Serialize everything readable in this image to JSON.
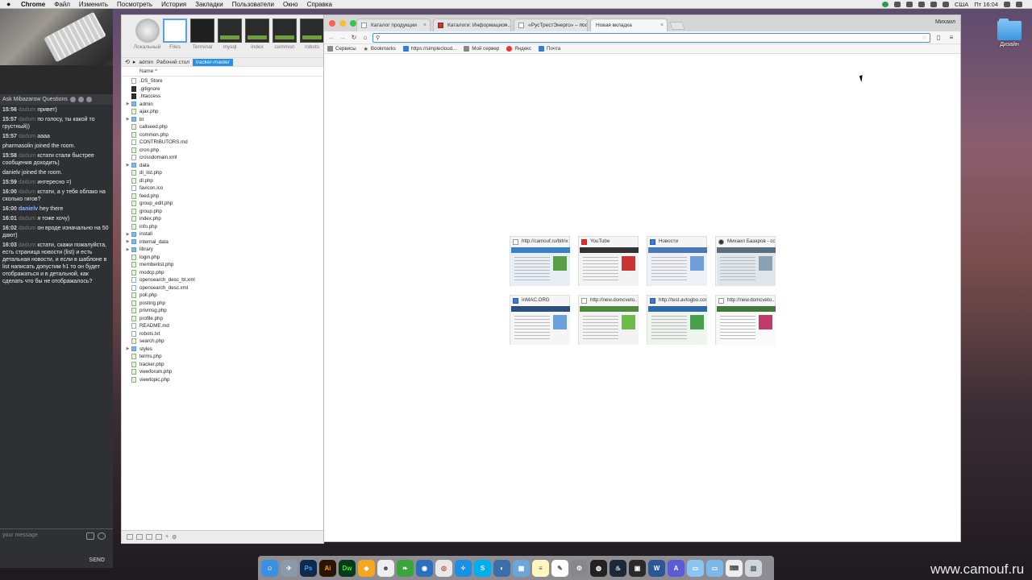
{
  "menubar": {
    "apple": "",
    "items": [
      "Chrome",
      "Файл",
      "Изменить",
      "Посмотреть",
      "История",
      "Закладки",
      "Пользователи",
      "Окно",
      "Справка"
    ],
    "lang": "США",
    "clock": "Пт 16:04"
  },
  "chat": {
    "title": "Ask Mibazarow Questions",
    "messages": [
      {
        "time": "15:56",
        "user": "dadum",
        "text": "привет)"
      },
      {
        "time": "15:57",
        "user": "dadum",
        "text": "по голосу, ты какой то грустный))"
      },
      {
        "time": "15:57",
        "user": "dadum",
        "text": "аааа"
      },
      {
        "time": "",
        "user": "",
        "text": "pharmasolin joined the room."
      },
      {
        "time": "15:58",
        "user": "dadum",
        "text": "кстати стали быстрее сообщения доходить)"
      },
      {
        "time": "",
        "user": "",
        "text": "danielv joined the room."
      },
      {
        "time": "15:59",
        "user": "dadum",
        "text": "интересно =)"
      },
      {
        "time": "16:00",
        "user": "dadum",
        "text": "кстати, а у тебя облако на сколько гигов?"
      },
      {
        "time": "16:00",
        "user": "danielv",
        "text": "hey there",
        "highlight": true
      },
      {
        "time": "16:01",
        "user": "dadum",
        "text": "я тоже хочу)"
      },
      {
        "time": "16:02",
        "user": "dadum",
        "text": "он вроде изначально на 50 дают)"
      },
      {
        "time": "16:03",
        "user": "dadum",
        "text": "кстати, скажи пожалуйста, есть страница новости (list) и есть детальная новости, и если в шаблоне в list написать допустим h1 то он будет отображаться и в детальной, как сделать что бы не отображалось?"
      }
    ],
    "input_placeholder": "your message",
    "send_label": "SEND"
  },
  "filemanager": {
    "toolbar": [
      {
        "label": "Локальный",
        "kind": "globe"
      },
      {
        "label": "Files",
        "kind": "sel"
      },
      {
        "label": "Terminal",
        "kind": "dark"
      },
      {
        "label": "mysql",
        "kind": "code"
      },
      {
        "label": "index",
        "kind": "code"
      },
      {
        "label": "common",
        "kind": "code"
      },
      {
        "label": "robots",
        "kind": "code"
      }
    ],
    "breadcrumb": [
      "admin",
      "Рабочий стол",
      "tracker-master"
    ],
    "column_name": "Name",
    "files": [
      {
        "name": ".DS_Store",
        "type": "file"
      },
      {
        "name": ".gitignore",
        "type": "dark"
      },
      {
        "name": ".htaccess",
        "type": "dark"
      },
      {
        "name": "admin",
        "type": "folder"
      },
      {
        "name": "ajax.php",
        "type": "php"
      },
      {
        "name": "bt",
        "type": "folder"
      },
      {
        "name": "callseed.php",
        "type": "php"
      },
      {
        "name": "common.php",
        "type": "php"
      },
      {
        "name": "CONTRIBUTORS.md",
        "type": "file"
      },
      {
        "name": "cron.php",
        "type": "php"
      },
      {
        "name": "crossdomain.xml",
        "type": "file"
      },
      {
        "name": "data",
        "type": "folder"
      },
      {
        "name": "dl_list.php",
        "type": "php"
      },
      {
        "name": "dl.php",
        "type": "php"
      },
      {
        "name": "favicon.ico",
        "type": "file"
      },
      {
        "name": "feed.php",
        "type": "php"
      },
      {
        "name": "group_edit.php",
        "type": "php"
      },
      {
        "name": "group.php",
        "type": "php"
      },
      {
        "name": "index.php",
        "type": "php"
      },
      {
        "name": "info.php",
        "type": "php"
      },
      {
        "name": "install",
        "type": "folder"
      },
      {
        "name": "internal_data",
        "type": "folder"
      },
      {
        "name": "library",
        "type": "folder"
      },
      {
        "name": "login.php",
        "type": "php"
      },
      {
        "name": "memberlist.php",
        "type": "php"
      },
      {
        "name": "modcp.php",
        "type": "php"
      },
      {
        "name": "opensearch_desc_bt.xml",
        "type": "file"
      },
      {
        "name": "opensearch_desc.xml",
        "type": "file"
      },
      {
        "name": "poll.php",
        "type": "php"
      },
      {
        "name": "posting.php",
        "type": "php"
      },
      {
        "name": "privmsg.php",
        "type": "php"
      },
      {
        "name": "profile.php",
        "type": "php"
      },
      {
        "name": "README.md",
        "type": "file"
      },
      {
        "name": "robots.txt",
        "type": "file"
      },
      {
        "name": "search.php",
        "type": "php"
      },
      {
        "name": "styles",
        "type": "folder"
      },
      {
        "name": "terms.php",
        "type": "php"
      },
      {
        "name": "tracker.php",
        "type": "php"
      },
      {
        "name": "viewforum.php",
        "type": "php"
      },
      {
        "name": "viewtopic.php",
        "type": "php"
      }
    ]
  },
  "browser": {
    "profile": "Михаил",
    "tabs": [
      {
        "title": "Каталог продукции",
        "fav": "plain",
        "active": false
      },
      {
        "title": "Каталоги: Информацион...",
        "fav": "red",
        "active": false
      },
      {
        "title": "«РусТрестЭнерго» – пос...",
        "fav": "plain",
        "active": false
      },
      {
        "title": "Новая вкладка",
        "fav": "none",
        "active": true
      }
    ],
    "url": "",
    "bookmarks": [
      {
        "label": "Сервисы",
        "icon": "grid"
      },
      {
        "label": "Bookmarks",
        "icon": "star"
      },
      {
        "label": "https://simplecloud...",
        "icon": "blue"
      },
      {
        "label": "Мой сервер",
        "icon": "plain"
      },
      {
        "label": "Яндекс",
        "icon": "y"
      },
      {
        "label": "Почта",
        "icon": "blue"
      }
    ],
    "tiles": [
      {
        "title": "http://camouf.ru/bitrix",
        "fav": "plain"
      },
      {
        "title": "YouTube",
        "fav": "yt"
      },
      {
        "title": "Новости",
        "fav": "blue"
      },
      {
        "title": "Михаил Базаров - co...",
        "fav": "circle"
      },
      {
        "title": "InMAC.ORG",
        "fav": "blue"
      },
      {
        "title": "http://new.domcveto...",
        "fav": "plain"
      },
      {
        "title": "http://test.avtogbo.com",
        "fav": "blue"
      },
      {
        "title": "http://new.domcveto...",
        "fav": "plain"
      }
    ]
  },
  "desktop": {
    "folder_label": "Дизайн"
  },
  "watermark": "www.camouf.ru"
}
